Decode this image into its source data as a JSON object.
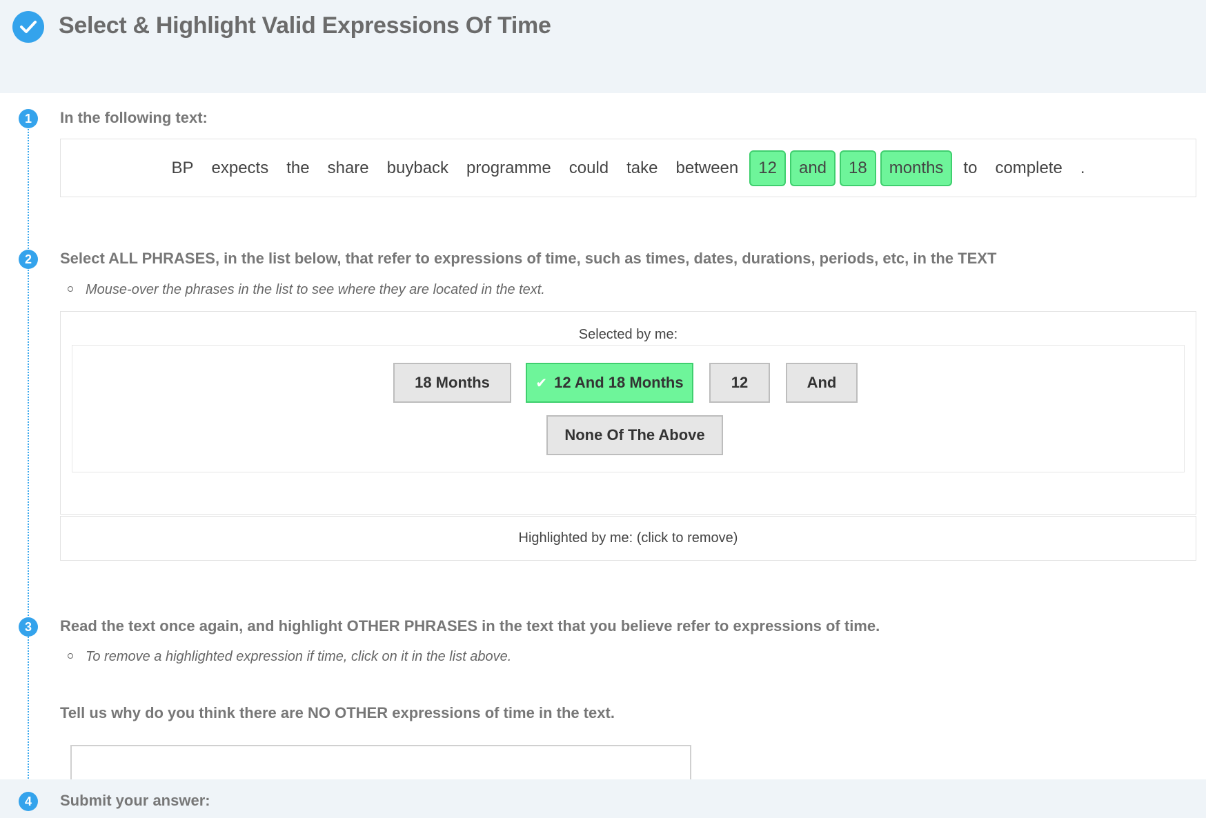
{
  "header": {
    "title": "Select & Highlight Valid Expressions Of Time",
    "icon": "check-circle-icon"
  },
  "step1": {
    "number": "1",
    "title": "In the following text:",
    "tokens": [
      {
        "text": "BP",
        "highlighted": false
      },
      {
        "text": "expects",
        "highlighted": false
      },
      {
        "text": "the",
        "highlighted": false
      },
      {
        "text": "share",
        "highlighted": false
      },
      {
        "text": "buyback",
        "highlighted": false
      },
      {
        "text": "programme",
        "highlighted": false
      },
      {
        "text": "could",
        "highlighted": false
      },
      {
        "text": "take",
        "highlighted": false
      },
      {
        "text": "between",
        "highlighted": false
      },
      {
        "text": "12",
        "highlighted": true
      },
      {
        "text": "and",
        "highlighted": true
      },
      {
        "text": "18",
        "highlighted": true
      },
      {
        "text": "months",
        "highlighted": true
      },
      {
        "text": "to",
        "highlighted": false
      },
      {
        "text": "complete",
        "highlighted": false
      },
      {
        "text": ".",
        "highlighted": false
      }
    ]
  },
  "step2": {
    "number": "2",
    "title": "Select ALL PHRASES, in the list below, that refer to expressions of time, such as times, dates, durations, periods, etc, in the TEXT",
    "hint": "Mouse-over the phrases in the list to see where they are located in the text.",
    "selected_label": "Selected by me:",
    "phrases": [
      {
        "label": "18 Months",
        "selected": false
      },
      {
        "label": "12 And 18 Months",
        "selected": true
      },
      {
        "label": "12",
        "selected": false
      },
      {
        "label": "And",
        "selected": false
      },
      {
        "label": "None Of The Above",
        "selected": false
      }
    ],
    "highlighted_label": "Highlighted by me: (click to remove)"
  },
  "step3": {
    "number": "3",
    "title": "Read the text once again, and highlight OTHER PHRASES in the text that you believe refer to expressions of time.",
    "hint": "To remove a highlighted expression if time, click on it in the list above.",
    "reason_question": "Tell us why do you think there are NO OTHER expressions of time in the text.",
    "reason_value": ""
  },
  "step4": {
    "number": "4",
    "title": "Submit your answer:"
  },
  "colors": {
    "accent": "#34a3ec",
    "highlight": "#6ef59a",
    "header_bg": "#eff4f8"
  }
}
